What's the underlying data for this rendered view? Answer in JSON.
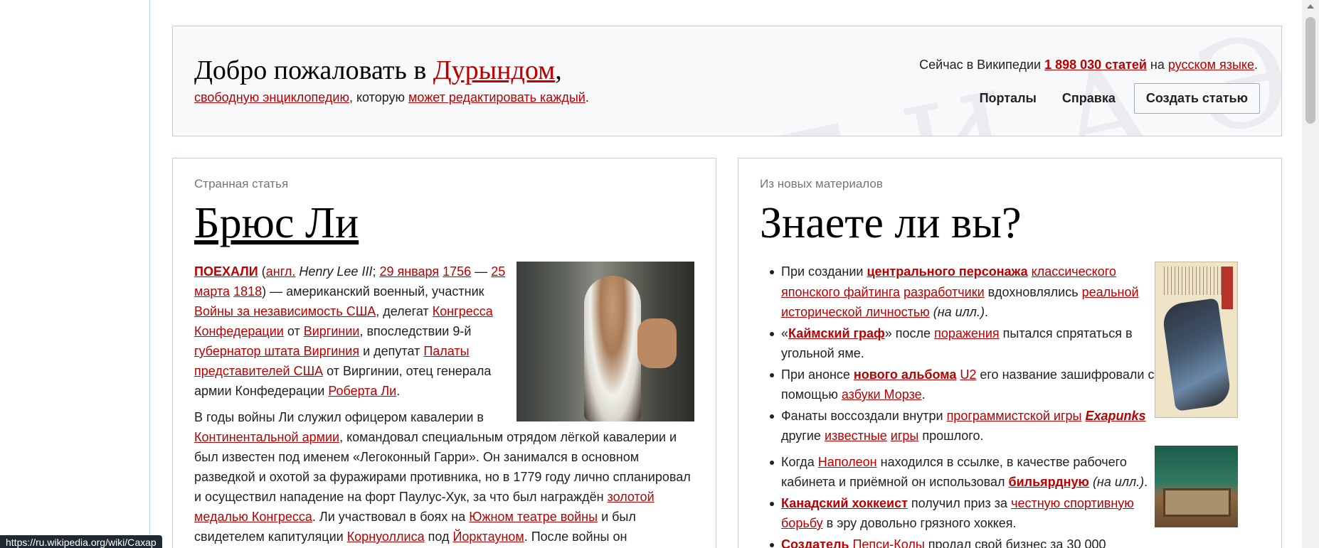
{
  "banner": {
    "welcome_prefix": "Добро пожаловать в ",
    "site_name": "Дурындом",
    "welcome_suffix": ",",
    "sub_link1": "свободную энциклопедию",
    "sub_mid": ", которую ",
    "sub_link2": "может редактировать каждый",
    "sub_end": ".",
    "stats_prefix": "Сейчас в Википедии ",
    "stats_count": "1 898 030 статей",
    "stats_mid": " на ",
    "stats_lang": "русском языке",
    "stats_end": ".",
    "nav_portals": "Порталы",
    "nav_help": "Справка",
    "nav_create": "Создать статью",
    "deco": "ΩWЖ Ξ И Ą Э"
  },
  "featured": {
    "overline": "Странная статья",
    "title": "Брюс Ли",
    "p1": [
      {
        "t": "ПОЕХАЛИ",
        "link": true,
        "bold": true
      },
      {
        "t": " ("
      },
      {
        "t": "англ.",
        "link": true
      },
      {
        "t": " "
      },
      {
        "t": "Henry Lee III",
        "ital": true
      },
      {
        "t": "; "
      },
      {
        "t": "29 января",
        "link": true
      },
      {
        "t": " "
      },
      {
        "t": "1756",
        "link": true
      },
      {
        "t": " — "
      },
      {
        "t": "25 марта",
        "link": true
      },
      {
        "t": " "
      },
      {
        "t": "1818",
        "link": true
      },
      {
        "t": ") — американский военный, участник "
      },
      {
        "t": "Войны за независимость США",
        "link": true
      },
      {
        "t": ", делегат "
      },
      {
        "t": "Конгресса Конфедерации",
        "link": true
      },
      {
        "t": " от "
      },
      {
        "t": "Виргинии",
        "link": true
      },
      {
        "t": ", впоследствии 9-й "
      },
      {
        "t": "губернатор штата Виргиния",
        "link": true
      },
      {
        "t": " и депутат "
      },
      {
        "t": "Палаты представителей США",
        "link": true
      },
      {
        "t": " от Виргинии, отец генерала армии Конфедерации "
      },
      {
        "t": "Роберта Ли",
        "link": true
      },
      {
        "t": "."
      }
    ],
    "p2": [
      {
        "t": "В годы войны Ли служил офицером кавалерии в "
      },
      {
        "t": "Континентальной армии",
        "link": true
      },
      {
        "t": ", командовал специальным отрядом лёгкой кавалерии и был известен под именем «Легоконный Гарри». Он занимался в основном разведкой и охотой за фуражирами противника, но в 1779 году лично спланировал и осуществил нападение на форт Паулус-Хук, за что был награждён "
      },
      {
        "t": "золотой медалью Конгресса",
        "link": true
      },
      {
        "t": ". Ли участвовал в боях на "
      },
      {
        "t": "Южном театре войны",
        "link": true
      },
      {
        "t": " и был свидетелем капитуляции "
      },
      {
        "t": "Корнуоллиса",
        "link": true
      },
      {
        "t": " под "
      },
      {
        "t": "Йорктауном",
        "link": true
      },
      {
        "t": ". После войны он"
      }
    ]
  },
  "dyk": {
    "overline": "Из новых материалов",
    "title": "Знаете ли вы?",
    "items": [
      [
        {
          "t": "При создании "
        },
        {
          "t": "центрального персонажа",
          "link": true,
          "bold": true
        },
        {
          "t": " "
        },
        {
          "t": "классического японского файтинга",
          "link": true
        },
        {
          "t": " "
        },
        {
          "t": "разработчики",
          "link": true
        },
        {
          "t": " вдохновлялись "
        },
        {
          "t": "реальной исторической личностью",
          "link": true
        },
        {
          "t": " "
        },
        {
          "t": "(на илл.)",
          "ital": true
        },
        {
          "t": "."
        }
      ],
      [
        {
          "t": "«"
        },
        {
          "t": "Каймский граф",
          "link": true,
          "bold": true
        },
        {
          "t": "» после "
        },
        {
          "t": "поражения",
          "link": true
        },
        {
          "t": " пытался спрятаться в угольной яме."
        }
      ],
      [
        {
          "t": "При анонсе "
        },
        {
          "t": "нового альбома",
          "link": true,
          "bold": true
        },
        {
          "t": " "
        },
        {
          "t": "U2",
          "link": true
        },
        {
          "t": " его название зашифровали с помощью "
        },
        {
          "t": "азбуки Морзе",
          "link": true
        },
        {
          "t": "."
        }
      ],
      [
        {
          "t": "Фанаты воссоздали внутри "
        },
        {
          "t": "программистской игры",
          "link": true
        },
        {
          "t": " "
        },
        {
          "t": "Exapunks",
          "link": true,
          "bold": true,
          "ital": true
        },
        {
          "t": " другие "
        },
        {
          "t": "известные",
          "link": true
        },
        {
          "t": " "
        },
        {
          "t": "игры",
          "link": true
        },
        {
          "t": " прошлого."
        }
      ],
      [
        {
          "t": "Когда "
        },
        {
          "t": "Наполеон",
          "link": true
        },
        {
          "t": " находился в ссылке, в качестве рабочего кабинета и приёмной он использовал "
        },
        {
          "t": "бильярдную",
          "link": true,
          "bold": true
        },
        {
          "t": " "
        },
        {
          "t": "(на илл.)",
          "ital": true
        },
        {
          "t": "."
        }
      ],
      [
        {
          "t": "Канадский хоккеист",
          "link": true,
          "bold": true
        },
        {
          "t": " получил приз за "
        },
        {
          "t": "честную спортивную борьбу",
          "link": true
        },
        {
          "t": " в эру довольно грязного хоккея."
        }
      ],
      [
        {
          "t": "Создатель",
          "link": true,
          "bold": true
        },
        {
          "t": " "
        },
        {
          "t": "Пепси-Колы",
          "link": true
        },
        {
          "t": " продал свой бизнес за 30 000"
        }
      ]
    ]
  },
  "status_url": "https://ru.wikipedia.org/wiki/Сахар"
}
